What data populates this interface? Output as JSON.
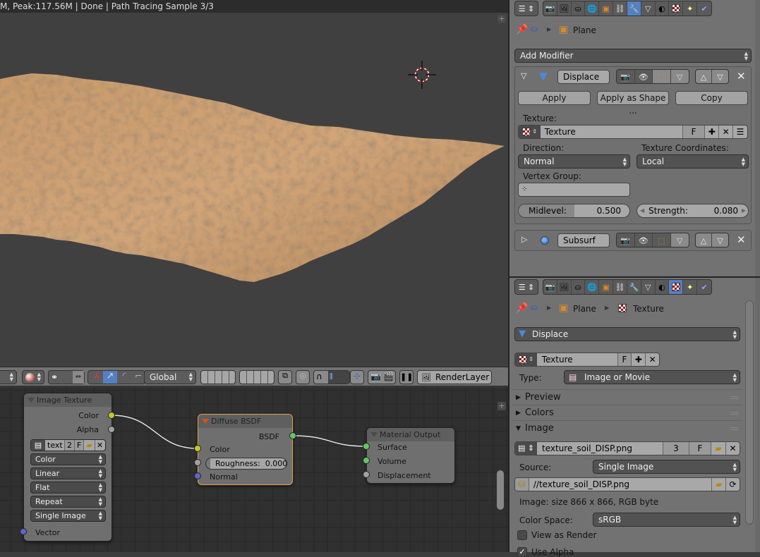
{
  "viewport": {
    "status_text": "M, Peak:117.56M | Done | Path Tracing Sample 3/3",
    "add_icon": "+"
  },
  "header3d": {
    "transform_orientation": "Global",
    "render_layer": "RenderLayer"
  },
  "nodes": {
    "image_texture": {
      "title": "Image Texture",
      "outputs": [
        "Color",
        "Alpha"
      ],
      "image_name": "text",
      "users": "2",
      "fake": "F",
      "color_mode": "Color",
      "interpolation": "Linear",
      "projection": "Flat",
      "extension": "Repeat",
      "source": "Single Image",
      "input": "Vector"
    },
    "diffuse": {
      "title": "Diffuse BSDF",
      "output": "BSDF",
      "color_label": "Color",
      "roughness_label": "Roughness:",
      "roughness_value": "0.000",
      "normal_label": "Normal"
    },
    "material_output": {
      "title": "Material Output",
      "inputs": [
        "Surface",
        "Volume",
        "Displacement"
      ]
    }
  },
  "modifiers_panel": {
    "breadcrumb_object": "Plane",
    "add_modifier": "Add Modifier",
    "displace": {
      "name": "Displace",
      "apply": "Apply",
      "apply_shape": "Apply as Shape ...",
      "copy": "Copy",
      "texture_label": "Texture:",
      "texture_name": "Texture",
      "fake": "F",
      "direction_label": "Direction:",
      "direction": "Normal",
      "coords_label": "Texture Coordinates:",
      "coords": "Local",
      "vgroup_label": "Vertex Group:",
      "vgroup_value": "",
      "midlevel_label": "Midlevel:",
      "midlevel": "0.500",
      "midlevel_fraction": 0.5,
      "strength_label": "Strength:",
      "strength": "0.080"
    },
    "subsurf": {
      "name": "Subsurf"
    }
  },
  "texture_panel": {
    "breadcrumb_object": "Plane",
    "breadcrumb_texture": "Texture",
    "user": "Displace",
    "texture_name": "Texture",
    "fake": "F",
    "type_label": "Type:",
    "type": "Image or Movie",
    "sections": {
      "preview": "Preview",
      "colors": "Colors",
      "image": "Image"
    },
    "image_name": "texture_soil_DISP.png",
    "users": "3",
    "image_fake": "F",
    "source_label": "Source:",
    "source": "Single Image",
    "filepath": "//texture_soil_DISP.png",
    "info": "Image: size 866 x 866, RGB byte",
    "colorspace_label": "Color Space:",
    "colorspace": "sRGB",
    "view_as_render": "View as Render",
    "use_alpha": "Use Alpha",
    "view_as_render_checked": false,
    "use_alpha_checked": true
  },
  "colors": {
    "active_tab": "#5680c2",
    "socket_color": "#c7c729",
    "socket_shader": "#63c763",
    "socket_vector": "#6363c7",
    "socket_gray": "#a1a1a1",
    "node_selected_border": "#e6a24b"
  }
}
